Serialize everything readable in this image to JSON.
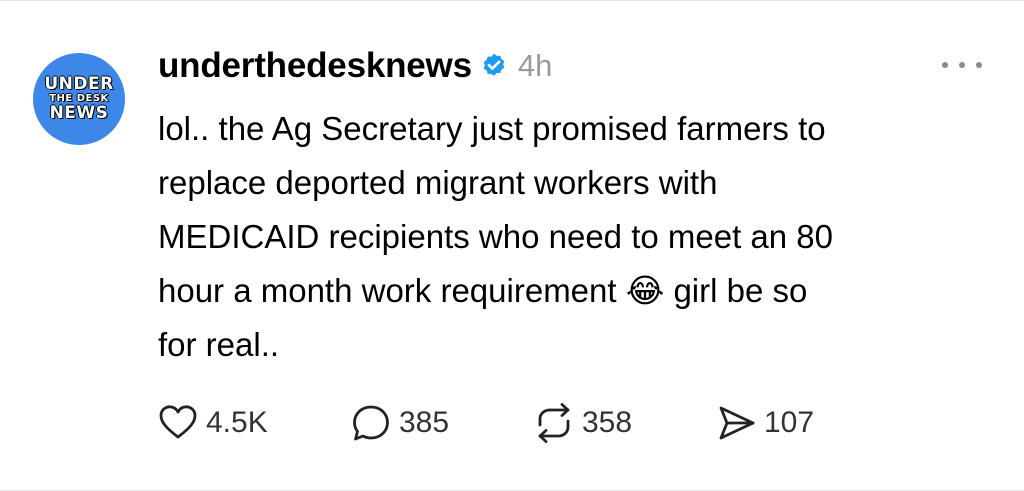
{
  "post": {
    "avatar": {
      "line1": "UNDER",
      "line2": "THE DESK",
      "line3": "NEWS",
      "background": "#3d87e8"
    },
    "username": "underthedesknews",
    "verified_icon": "verified-badge-icon",
    "timestamp": "4h",
    "more_icon": "more-horizontal-icon",
    "text": "lol.. the Ag Secretary just promised farmers to\nreplace deported migrant workers with\nMEDICAID recipients who need to meet an 80\nhour a month work requirement 😂 girl be so\nfor real..",
    "actions": {
      "like": {
        "icon": "heart-icon",
        "count": "4.5K"
      },
      "reply": {
        "icon": "comment-bubble-icon",
        "count": "385"
      },
      "repost": {
        "icon": "repost-icon",
        "count": "358"
      },
      "share": {
        "icon": "send-icon",
        "count": "107"
      }
    },
    "colors": {
      "accent": "#1d9bf0",
      "secondary_text": "#9a9a9a"
    }
  }
}
